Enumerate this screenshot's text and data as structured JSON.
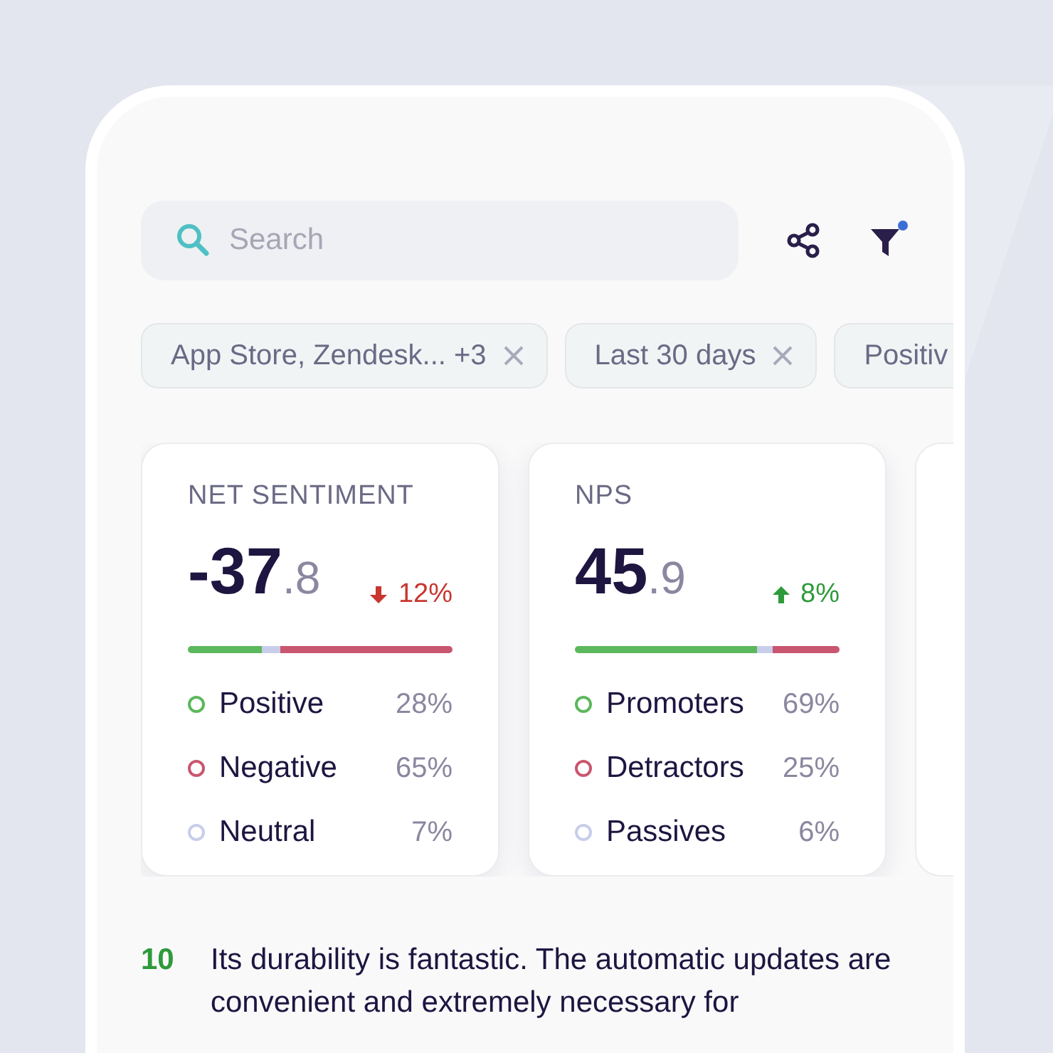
{
  "search": {
    "placeholder": "Search"
  },
  "filter_active": true,
  "chips": [
    {
      "label": "App Store, Zendesk... +3",
      "removable": true
    },
    {
      "label": "Last 30 days",
      "removable": true
    },
    {
      "label": "Positiv",
      "removable": false
    }
  ],
  "cards": [
    {
      "title": "NET SENTIMENT",
      "value_whole": "-37",
      "value_decimal": ".8",
      "change": "12%",
      "kind": "down",
      "items": [
        {
          "label": "Positive",
          "value": "28%",
          "color": "#5cb85c"
        },
        {
          "label": "Negative",
          "value": "65%",
          "color": "#c9566f"
        },
        {
          "label": "Neutral",
          "value": "7%",
          "color": "#c8cdea"
        }
      ]
    },
    {
      "title": "NPS",
      "value_whole": "45",
      "value_decimal": ".9",
      "change": "8%",
      "kind": "up",
      "items": [
        {
          "label": "Promoters",
          "value": "69%",
          "color": "#5cb85c"
        },
        {
          "label": "Detractors",
          "value": "25%",
          "color": "#c9566f"
        },
        {
          "label": "Passives",
          "value": "6%",
          "color": "#c8cdea"
        }
      ]
    }
  ],
  "review": {
    "score": "10",
    "text": "Its durability is fantastic. The automatic updates are convenient and extremely necessary for"
  }
}
